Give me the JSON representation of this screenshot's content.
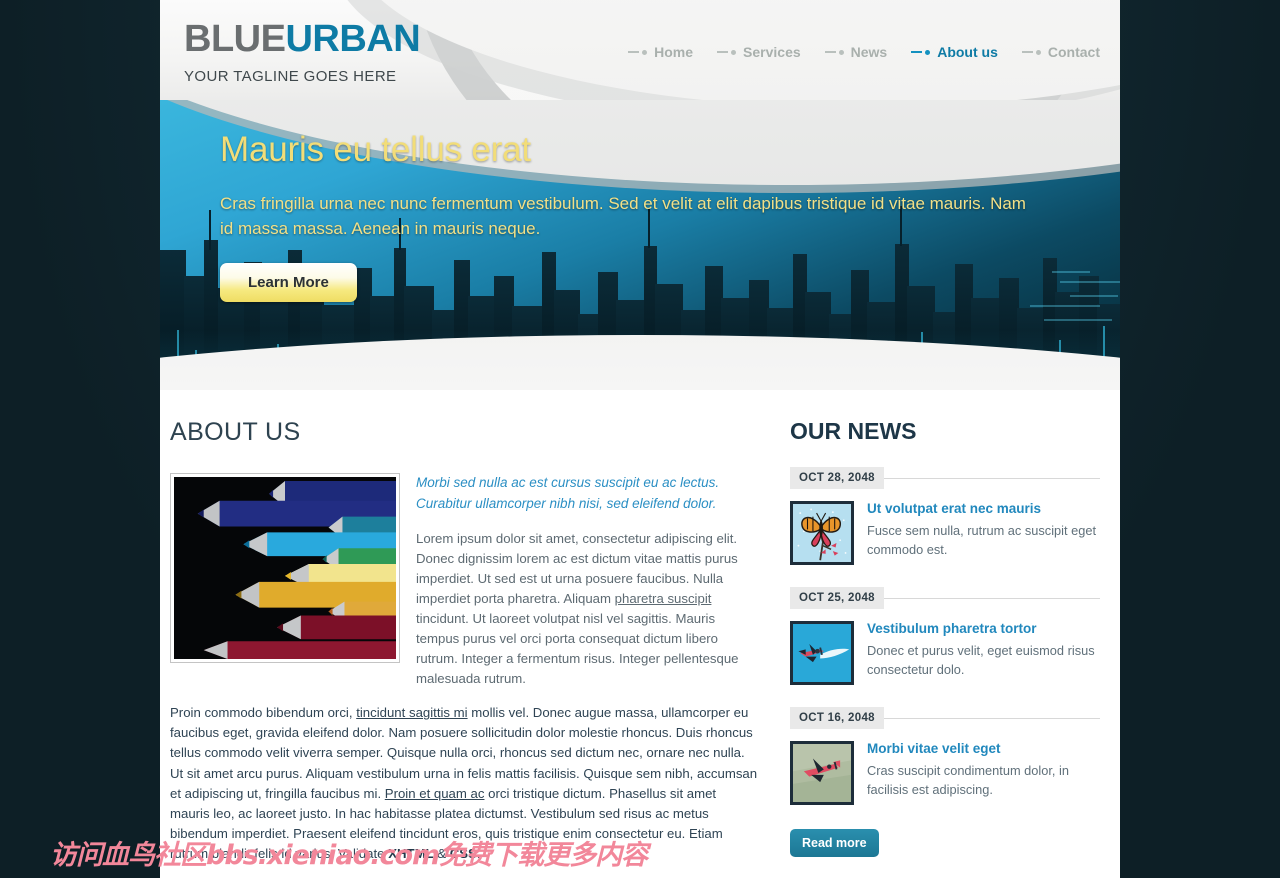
{
  "brand": {
    "logo_part1": "BLUE",
    "logo_part2": "URBAN",
    "tagline": "YOUR TAGLINE GOES HERE",
    "accent_color": "#0e7ba5",
    "logo_gray": "#6a6e70"
  },
  "nav": {
    "items": [
      {
        "label": "Home",
        "active": false
      },
      {
        "label": "Services",
        "active": false
      },
      {
        "label": "News",
        "active": false
      },
      {
        "label": "About us",
        "active": true
      },
      {
        "label": "Contact",
        "active": false
      }
    ],
    "active_color": "#0e7ba5",
    "inactive_color": "#a9b0ad"
  },
  "hero": {
    "title": "Mauris eu tellus erat",
    "text": "Cras fringilla urna nec nunc fermentum vestibulum. Sed et velit at elit dapibus tristique id vitae mauris. Nam id massa massa. Aenean in mauris neque.",
    "button_label": "Learn More",
    "title_color": "#f2dd78",
    "image_subject": "city-skyline-silhouette"
  },
  "about": {
    "heading": "ABOUT US",
    "image_alt": "colored-pencils-photo",
    "lead": "Morbi sed nulla ac est cursus suscipit eu ac lectus. Curabitur ullamcorper nibh nisi, sed eleifend dolor.",
    "p1_a": "Lorem ipsum dolor sit amet, consectetur adipiscing elit. Donec dignissim lorem ac est dictum vitae mattis purus imperdiet. Ut sed est ut urna posuere faucibus. Nulla imperdiet porta pharetra. Aliquam ",
    "p1_link": "pharetra suscipit",
    "p1_b": " tincidunt. Ut laoreet volutpat nisl vel sagittis. Mauris tempus purus vel orci porta consequat dictum libero rutrum. Integer a fermentum risus. Integer pellentesque malesuada rutrum.",
    "p2_a": "Proin commodo bibendum orci, ",
    "p2_link1": "tincidunt sagittis mi",
    "p2_b": " mollis vel. Donec augue massa, ullamcorper eu faucibus eget, gravida eleifend dolor. Nam posuere sollicitudin dolor molestie rhoncus. Duis rhoncus tellus commodo velit viverra semper. Quisque nulla orci, rhoncus sed dictum nec, ornare nec nulla. Ut sit amet arcu purus. Aliquam vestibulum urna in felis mattis facilisis. Quisque sem nibh, accumsan et adipiscing ut, fringilla faucibus mi. ",
    "p2_link2": "Proin et quam ac",
    "p2_c": " orci tristique dictum. Phasellus sit amet mauris leo, ac laoreet justo. In hac habitasse platea dictumst. Vestibulum sed risus ac metus bibendum imperdiet. Praesent eleifend tincidunt eros, quis tristique enim consectetur eu. Etiam rutrum blandit felis id varius. Validate ",
    "p2_valid1": "XHTML",
    "p2_amp": " & ",
    "p2_valid2": "CSS",
    "p2_end": "."
  },
  "news": {
    "heading": "OUR NEWS",
    "read_more_label": "Read more",
    "items": [
      {
        "date": "OCT 28, 2048",
        "title": "Ut volutpat erat nec mauris",
        "desc": "Fusce sem nulla, rutrum ac suscipit eget commodo est.",
        "thumb": "butterfly-on-flower"
      },
      {
        "date": "OCT 25, 2048",
        "title": "Vestibulum pharetra tortor",
        "desc": "Donec et purus velit, eget euismod risus consectetur dolo.",
        "thumb": "airplane-sky-blue"
      },
      {
        "date": "OCT 16, 2048",
        "title": "Morbi vitae velit eget",
        "desc": "Cras suscipit condimentum dolor, in facilisis est adipiscing.",
        "thumb": "airplane-green-field"
      }
    ]
  },
  "watermark": {
    "text": "访问血鸟社区bbs.xieniao.com免费下载更多内容",
    "color": "#f2879a"
  }
}
